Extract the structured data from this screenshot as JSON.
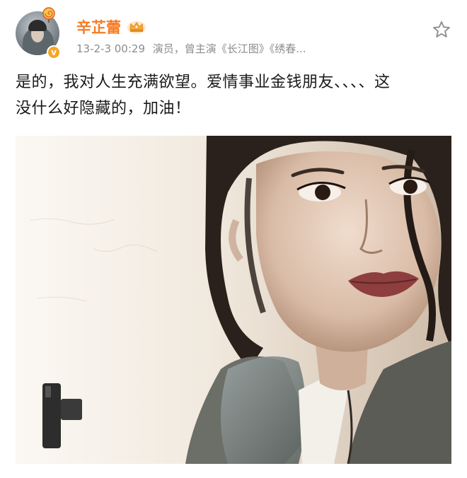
{
  "post": {
    "author": {
      "name": "辛芷蕾",
      "verified_mark": "v"
    },
    "meta": {
      "timestamp": "13-2-3 00:29",
      "bio": "演员，曾主演《长江图》《绣春..."
    },
    "text_line1": "是的，我对人生充满欲望。爱情事业金钱朋友、、、、这",
    "text_line2": "没什么好隐藏的，加油！",
    "icons": {
      "favorite": "star-outline-icon",
      "badge": "crown-icon",
      "avatar_decoration": "lollipop-icon"
    },
    "photo": {
      "description_kind": "portrait-photo"
    }
  },
  "colors": {
    "username": "#f77c23",
    "meta": "#8c8c8c",
    "text": "#1a1a1a",
    "verified": "#f6a623"
  }
}
